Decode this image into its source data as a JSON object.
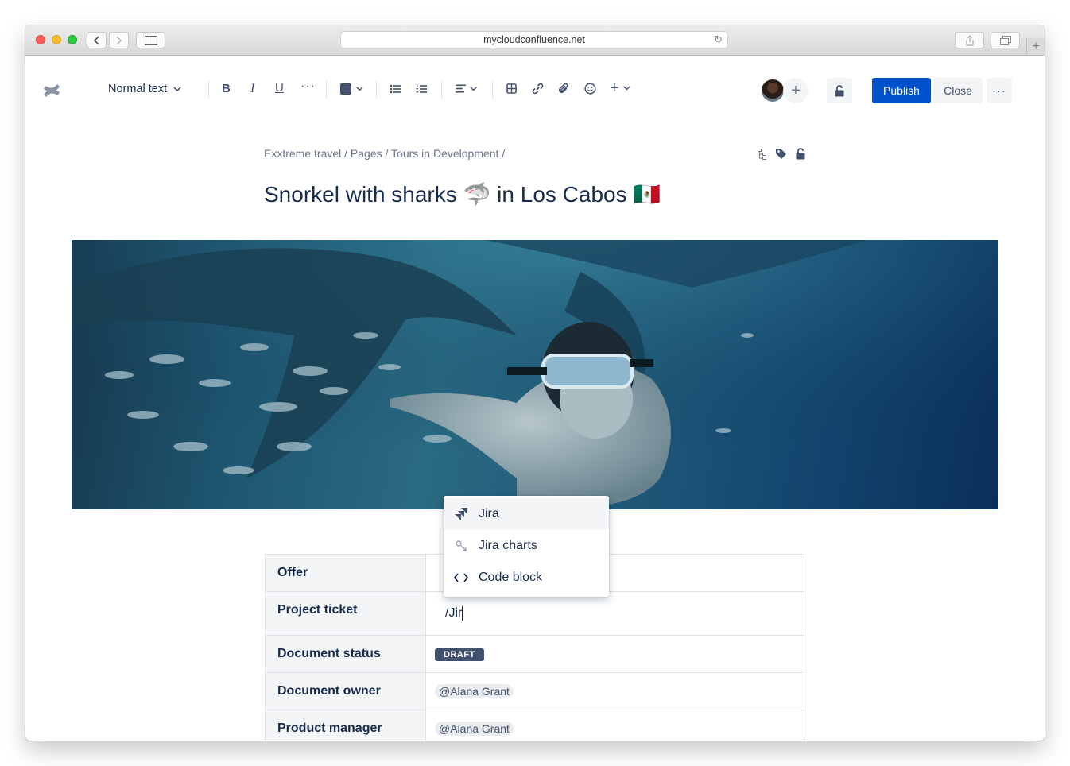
{
  "browser": {
    "url": "mycloudconfluence.net"
  },
  "toolbar": {
    "text_style": "Normal text",
    "publish_label": "Publish",
    "close_label": "Close",
    "more_label": "···",
    "insert_label": "+"
  },
  "breadcrumb": {
    "space": "Exxtreme travel",
    "pages": "Pages",
    "parent": "Tours in Development",
    "sep": "/"
  },
  "page": {
    "title": "Snorkel with sharks 🦈 in Los Cabos  🇲🇽"
  },
  "slash_menu": {
    "items": [
      {
        "label": "Jira",
        "icon": "jira-icon"
      },
      {
        "label": "Jira charts",
        "icon": "jira-charts-icon"
      },
      {
        "label": "Code block",
        "icon": "code-icon"
      }
    ]
  },
  "table": {
    "rows": [
      {
        "header": "Offer",
        "value": ""
      },
      {
        "header": "Project ticket",
        "value": "/Jir"
      },
      {
        "header": "Document status",
        "value": "DRAFT"
      },
      {
        "header": "Document owner",
        "value": "@Alana Grant"
      },
      {
        "header": "Product manager",
        "value": "@Alana Grant"
      }
    ]
  },
  "colors": {
    "primary": "#0052cc",
    "text": "#172b4d",
    "subtle": "#6b778c",
    "lozenge": "#42526e"
  }
}
